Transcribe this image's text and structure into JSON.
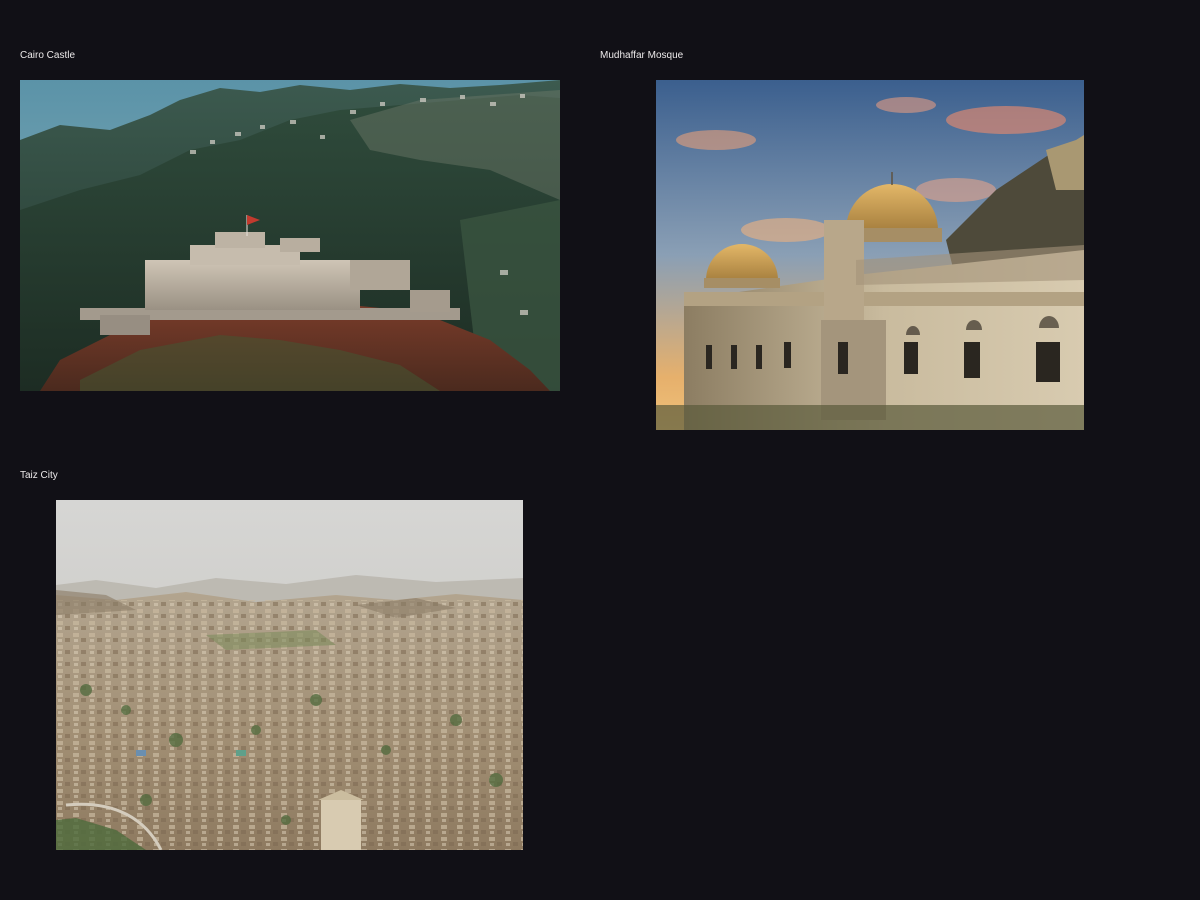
{
  "gallery": {
    "items": [
      {
        "caption": "Cairo Castle",
        "image": "castle-on-mountain-photo"
      },
      {
        "caption": "Mudhaffar Mosque",
        "image": "domed-mosque-at-sunset-photo"
      },
      {
        "caption": "Taiz City",
        "image": "aerial-city-view-photo"
      }
    ]
  },
  "colors": {
    "background": "#111016",
    "caption_text": "#ece9ea"
  }
}
